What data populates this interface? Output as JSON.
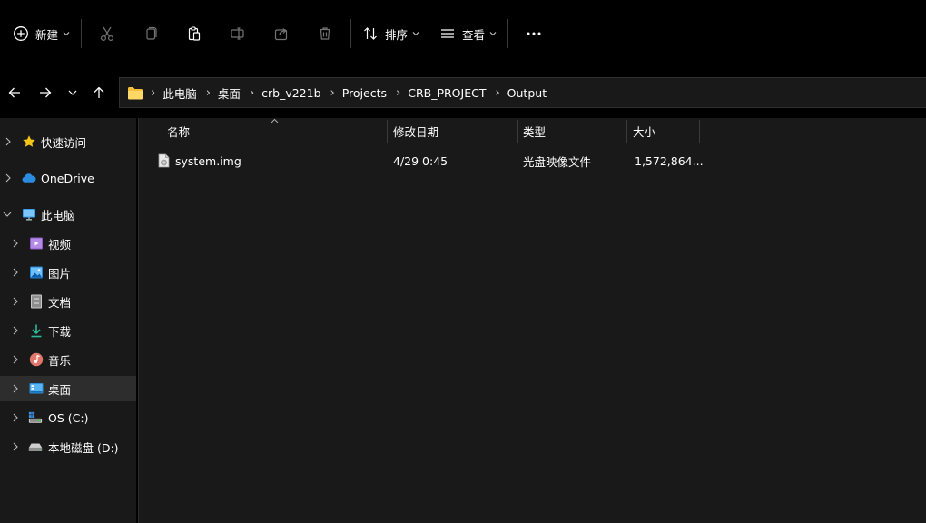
{
  "toolbar": {
    "new_label": "新建",
    "sort_label": "排序",
    "view_label": "查看",
    "more_label": "···"
  },
  "address": {
    "crumbs": [
      "此电脑",
      "桌面",
      "crb_v221b",
      "Projects",
      "CRB_PROJECT",
      "Output"
    ]
  },
  "sidebar": {
    "items": [
      {
        "label": "快速访问",
        "icon": "star-icon"
      },
      {
        "label": "OneDrive",
        "icon": "cloud-icon"
      },
      {
        "label": "此电脑",
        "icon": "computer-icon"
      },
      {
        "label": "视频",
        "icon": "video-icon"
      },
      {
        "label": "图片",
        "icon": "pictures-icon"
      },
      {
        "label": "文档",
        "icon": "documents-icon"
      },
      {
        "label": "下载",
        "icon": "download-icon"
      },
      {
        "label": "音乐",
        "icon": "music-icon"
      },
      {
        "label": "桌面",
        "icon": "desktop-icon"
      },
      {
        "label": "OS (C:)",
        "icon": "drive-c-icon"
      },
      {
        "label": "本地磁盘 (D:)",
        "icon": "drive-d-icon"
      }
    ]
  },
  "columns": {
    "name": "名称",
    "modified": "修改日期",
    "type": "类型",
    "size": "大小"
  },
  "files": [
    {
      "name": "system.img",
      "modified": "4/29 0:45",
      "type": "光盘映像文件",
      "size": "1,572,864..."
    }
  ],
  "colors": {
    "background": "#191919",
    "toolbar": "#000000",
    "selected": "#2d2d2d",
    "folder": "#f3c03b"
  }
}
